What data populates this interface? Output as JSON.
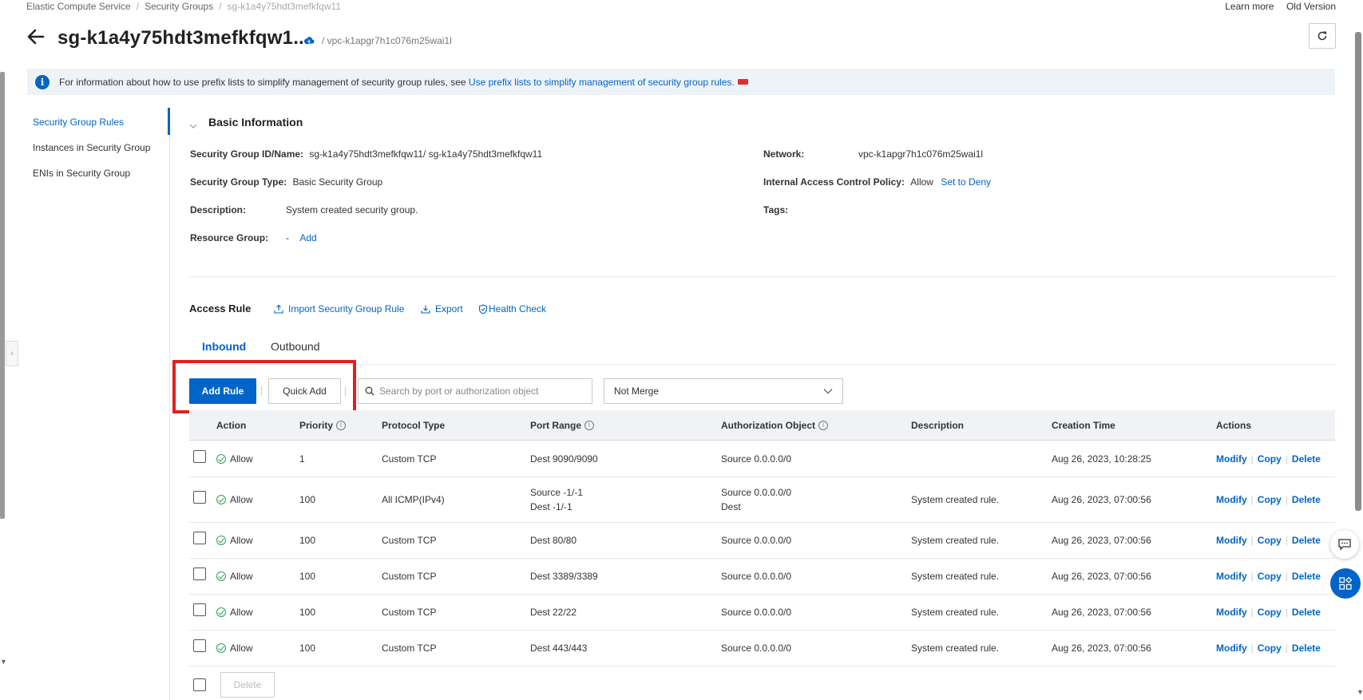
{
  "breadcrumb": {
    "items": [
      "Elastic Compute Service",
      "Security Groups"
    ],
    "current": "sg-k1a4y75hdt3mefkfqw11"
  },
  "top_links": {
    "learn_more": "Learn more",
    "old_version": "Old Version"
  },
  "header": {
    "title": "sg-k1a4y75hdt3mefkfqw1...",
    "vpc_crumb": "/ vpc-k1apgr7h1c076m25wai1l"
  },
  "notice": {
    "text": "For information about how to use prefix lists to simplify management of security group rules, see",
    "link": "Use prefix lists to simplify management of security group rules."
  },
  "sidebar": {
    "items": [
      {
        "label": "Security Group Rules",
        "active": true
      },
      {
        "label": "Instances in Security Group",
        "active": false
      },
      {
        "label": "ENIs in Security Group",
        "active": false
      }
    ]
  },
  "basic_info": {
    "title": "Basic Information",
    "id_name_label": "Security Group ID/Name",
    "id_name_value": "sg-k1a4y75hdt3mefkfqw11/ sg-k1a4y75hdt3mefkfqw11",
    "type_label": "Security Group Type",
    "type_value": "Basic Security Group",
    "description_label": "Description",
    "description_value": "System created security group.",
    "resource_group_label": "Resource Group",
    "resource_group_value": "-",
    "resource_group_add": "Add",
    "network_label": "Network",
    "network_value": "vpc-k1apgr7h1c076m25wai1l",
    "policy_label": "Internal Access Control Policy",
    "policy_value": "Allow",
    "policy_link": "Set to Deny",
    "tags_label": "Tags"
  },
  "access_rule": {
    "title": "Access Rule",
    "import_label": "Import Security Group Rule",
    "export_label": "Export",
    "health_label": "Health Check"
  },
  "tabs": [
    {
      "label": "Inbound",
      "active": true
    },
    {
      "label": "Outbound",
      "active": false
    }
  ],
  "toolbar": {
    "add_rule": "Add Rule",
    "quick_add": "Quick Add",
    "search_placeholder": "Search by port or authorization object",
    "merge_select": "Not Merge"
  },
  "table": {
    "headers": {
      "action": "Action",
      "priority": "Priority",
      "protocol": "Protocol Type",
      "port": "Port Range",
      "auth": "Authorization Object",
      "description": "Description",
      "created": "Creation Time",
      "actions": "Actions"
    },
    "row_actions": {
      "modify": "Modify",
      "copy": "Copy",
      "delete": "Delete"
    },
    "rows": [
      {
        "action": "Allow",
        "priority": "1",
        "protocol": "Custom TCP",
        "port": "Dest 9090/9090",
        "port2": "",
        "auth": "Source 0.0.0.0/0",
        "auth2": "",
        "description": "",
        "created": "Aug 26, 2023, 10:28:25"
      },
      {
        "action": "Allow",
        "priority": "100",
        "protocol": "All ICMP(IPv4)",
        "port": "Source -1/-1",
        "port2": "Dest -1/-1",
        "auth": "Source 0.0.0.0/0",
        "auth2": "Dest",
        "description": "System created rule.",
        "created": "Aug 26, 2023, 07:00:56"
      },
      {
        "action": "Allow",
        "priority": "100",
        "protocol": "Custom TCP",
        "port": "Dest 80/80",
        "port2": "",
        "auth": "Source 0.0.0.0/0",
        "auth2": "",
        "description": "System created rule.",
        "created": "Aug 26, 2023, 07:00:56"
      },
      {
        "action": "Allow",
        "priority": "100",
        "protocol": "Custom TCP",
        "port": "Dest 3389/3389",
        "port2": "",
        "auth": "Source 0.0.0.0/0",
        "auth2": "",
        "description": "System created rule.",
        "created": "Aug 26, 2023, 07:00:56"
      },
      {
        "action": "Allow",
        "priority": "100",
        "protocol": "Custom TCP",
        "port": "Dest 22/22",
        "port2": "",
        "auth": "Source 0.0.0.0/0",
        "auth2": "",
        "description": "System created rule.",
        "created": "Aug 26, 2023, 07:00:56"
      },
      {
        "action": "Allow",
        "priority": "100",
        "protocol": "Custom TCP",
        "port": "Dest 443/443",
        "port2": "",
        "auth": "Source 0.0.0.0/0",
        "auth2": "",
        "description": "System created rule.",
        "created": "Aug 26, 2023, 07:00:56"
      }
    ],
    "footer_delete": "Delete"
  },
  "colors": {
    "accent": "#0064c8",
    "highlight_box": "#e02020",
    "allow_icon": "#2aa34a"
  }
}
